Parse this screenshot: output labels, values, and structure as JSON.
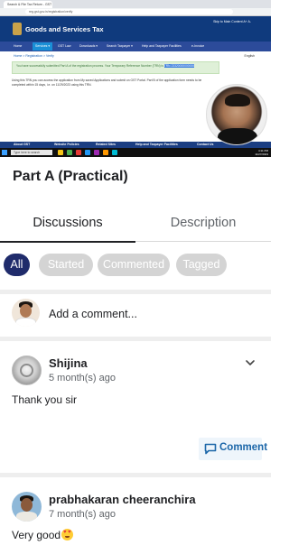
{
  "video": {
    "browser_tab_title": "Search & File Tax Return - GST Por...",
    "url": "reg.gst.gov.in/registration/verify",
    "site_title": "Goods and Services Tax",
    "top_right_links": "Skip to Main Content   A+  A-",
    "nav_items": [
      "Home",
      "Services ▾",
      "GST Law",
      "Downloads ▾",
      "Search Taxpayer ▾",
      "Help and Taxpayer Facilities",
      "e-Invoice"
    ],
    "breadcrumb": "Home > Registration > Verify",
    "language": "English",
    "success_message": "You have successfully submitted Part A of the registration process. Your Temporary Reference Number (TRN) is",
    "trn": "TRN 23320000000000",
    "info_text": "Using this TRN you can access the application from My saved Applications and submit on GST Portal. Part B of the application form needs to be completed within 15 days, i.e. on 11/29/2023 using this TRN.",
    "footer_links": [
      "About GST",
      "Website Policies",
      "Related Sites",
      "Help and Taxpayer Facilities",
      "Contact Us"
    ],
    "taskbar_search": "Type here to search",
    "clock_time": "4:11 PM",
    "clock_date": "11/27/2023"
  },
  "page": {
    "title": "Part A (Practical)"
  },
  "tabs": {
    "discussions": "Discussions",
    "description": "Description"
  },
  "filters": [
    "All",
    "Started",
    "Commented",
    "Tagged"
  ],
  "add_comment": {
    "placeholder": "Add a comment..."
  },
  "comments": [
    {
      "author": "Shijina",
      "time": "5 month(s) ago",
      "text": "Thank you sir",
      "reply_label": "Comment"
    },
    {
      "author": "prabhakaran cheeranchira",
      "time": "7 month(s) ago",
      "text": "Very good"
    }
  ],
  "colors": {
    "active_chip": "#1f2b6b",
    "inactive_chip": "#d4d4d4",
    "link_blue": "#1b66a8",
    "gst_header": "#0f3a7d"
  },
  "icons": {
    "more": "chevron-down-icon",
    "reply": "comment-bubble-icon"
  }
}
